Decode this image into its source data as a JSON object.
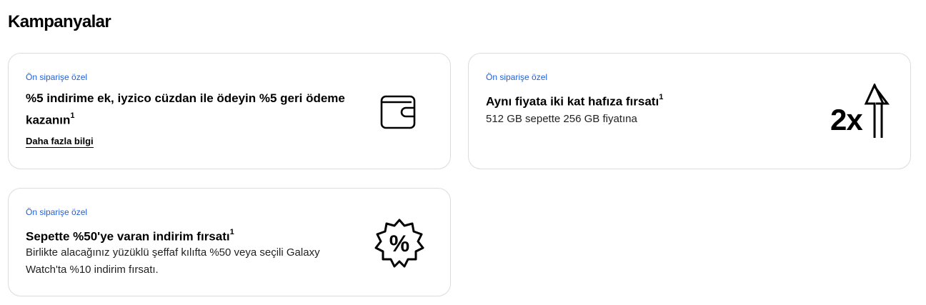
{
  "section": {
    "title": "Kampanyalar"
  },
  "cards": [
    {
      "tag": "Ön siparişe özel",
      "title": "%5 indirime ek, iyzico cüzdan ile ödeyin %5 geri ödeme kazanın",
      "sup": "1",
      "link": "Daha fazla bilgi",
      "icon": "wallet-icon"
    },
    {
      "tag": "Ön siparişe özel",
      "title": "Aynı fiyata iki kat hafıza fırsatı",
      "sup": "1",
      "desc": "512 GB sepette 256 GB fiyatına",
      "icon": "double-storage-icon",
      "icon_text": "2x"
    },
    {
      "tag": "Ön siparişe özel",
      "title": "Sepette %50'ye varan indirim fırsatı",
      "sup": "1",
      "desc": "Birlikte alacağınız yüzüklü şeffaf kılıfta %50 veya seçili Galaxy Watch'ta %10 indirim fırsatı.",
      "icon": "discount-badge-icon",
      "icon_text": "%"
    }
  ],
  "colors": {
    "tag": "#2260d8",
    "border": "#dcdcdc"
  }
}
